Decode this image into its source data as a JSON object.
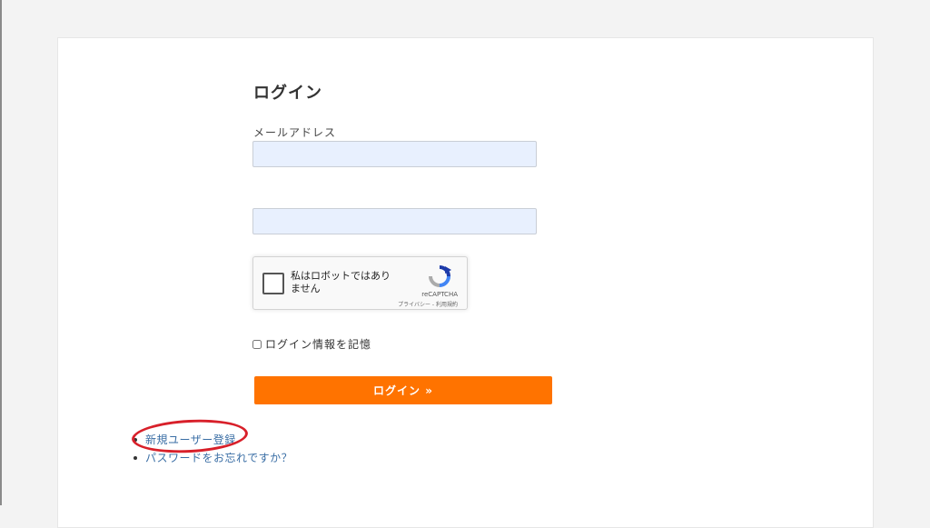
{
  "login": {
    "title": "ログイン",
    "email_label": "メールアドレス",
    "password_label": "",
    "email_value": "",
    "password_value": "",
    "remember_label": "ログイン情報を記憶",
    "submit_label": "ログイン »"
  },
  "captcha": {
    "text": "私はロボットではありません",
    "brand": "reCAPTCHA",
    "links": "プライバシー - 利用規約"
  },
  "links": {
    "register": "新規ユーザー登録",
    "forgot": "パスワードをお忘れですか？"
  },
  "colors": {
    "accent": "#ff7300",
    "highlight": "#d8202a",
    "link": "#3a6ea5"
  }
}
